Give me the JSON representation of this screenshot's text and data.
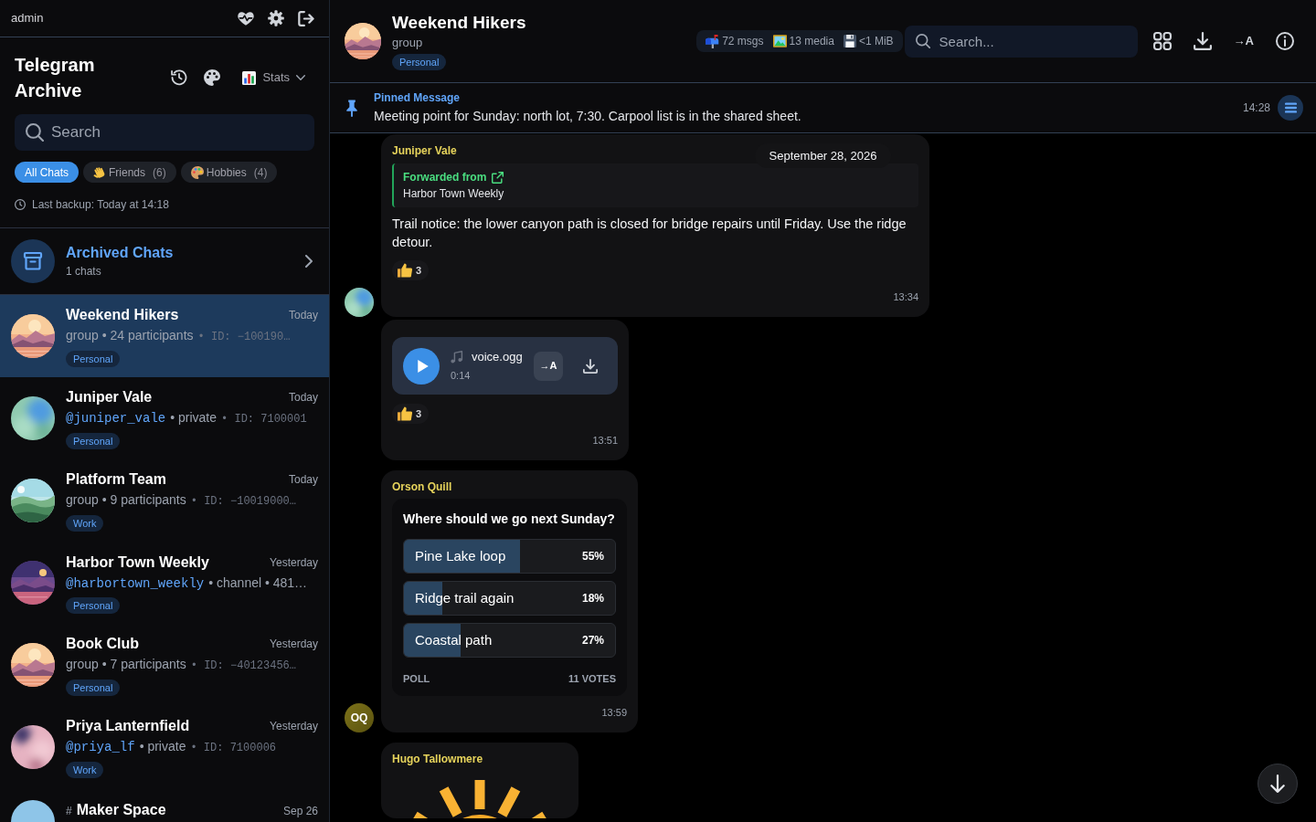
{
  "sidebar": {
    "user": "admin",
    "title": "Telegram Archive",
    "stats_menu": {
      "label": "Stats"
    },
    "search": {
      "placeholder": "Search"
    },
    "filters": [
      {
        "label": "All Chats",
        "selected": true
      },
      {
        "label": "Friends",
        "count": "(6)",
        "selected": false
      },
      {
        "label": "Hobbies",
        "count": "(4)",
        "selected": false
      }
    ],
    "last_backup": "Last backup: Today at 14:18",
    "archived": {
      "title": "Archived Chats",
      "subtitle": "1 chats"
    },
    "chats": [
      {
        "name": "Weekend Hikers",
        "date": "Today",
        "details": [
          {
            "kind": "plain",
            "text": "group • 24 participants"
          },
          {
            "kind": "id",
            "text": "• ID: −100190…"
          }
        ],
        "tag": "Personal",
        "selected": true
      },
      {
        "name": "Juniper Vale",
        "date": "Today",
        "details": [
          {
            "kind": "username",
            "text": "@juniper_vale"
          },
          {
            "kind": "plain",
            "text": "• private"
          },
          {
            "kind": "id",
            "text": "• ID: 7100001"
          }
        ],
        "tag": "Personal",
        "selected": false
      },
      {
        "name": "Platform Team",
        "date": "Today",
        "details": [
          {
            "kind": "plain",
            "text": "group • 9 participants"
          },
          {
            "kind": "id",
            "text": "• ID: −10019000…"
          }
        ],
        "tag": "Work",
        "selected": false
      },
      {
        "name": "Harbor Town Weekly",
        "date": "Yesterday",
        "details": [
          {
            "kind": "username",
            "text": "@harbortown_weekly"
          },
          {
            "kind": "plain",
            "text": "• channel • 481…"
          }
        ],
        "tag": "Personal",
        "selected": false
      },
      {
        "name": "Book Club",
        "date": "Yesterday",
        "details": [
          {
            "kind": "plain",
            "text": "group • 7 participants"
          },
          {
            "kind": "id",
            "text": "• ID: −40123456…"
          }
        ],
        "tag": "Personal",
        "selected": false
      },
      {
        "name": "Priya Lanternfield",
        "date": "Yesterday",
        "details": [
          {
            "kind": "username",
            "text": "@priya_lf"
          },
          {
            "kind": "plain",
            "text": "• private"
          },
          {
            "kind": "id",
            "text": "• ID: 7100006"
          }
        ],
        "tag": "Work",
        "selected": false
      },
      {
        "name": "Maker Space",
        "prefix": "#",
        "date": "Sep 26",
        "selected": false
      }
    ]
  },
  "chat_header": {
    "name": "Weekend Hikers",
    "type": "group",
    "tag": "Personal",
    "stats": [
      {
        "kind": "messages",
        "text": "72 msgs"
      },
      {
        "kind": "media",
        "text": "13 media"
      },
      {
        "kind": "size",
        "text": "<1 MiB"
      }
    ],
    "search": {
      "placeholder": "Search..."
    },
    "translate_label": "→A"
  },
  "pinned": {
    "label": "Pinned Message",
    "text": "Meeting point for Sunday: north lot, 7:30. Carpool list is in the shared sheet.",
    "time": "14:28"
  },
  "date_header": "September 28, 2026",
  "messages": [
    {
      "kind": "text",
      "sender": "Juniper Vale",
      "forwarded": {
        "label": "Forwarded from",
        "source": "Harbor Town Weekly"
      },
      "text": "Trail notice: the lower canyon path is closed for bridge repairs until Friday. Use the ridge detour.",
      "reactions": [
        {
          "count": "3"
        }
      ],
      "time": "13:34",
      "avatar": {
        "kind": "image"
      }
    },
    {
      "kind": "voice",
      "voice": {
        "file": "voice.ogg",
        "duration": "0:14",
        "translate_label": "→A"
      },
      "reactions": [
        {
          "count": "3"
        }
      ],
      "time": "13:51"
    },
    {
      "kind": "poll",
      "sender": "Orson Quill",
      "poll": {
        "question": "Where should we go next Sunday?",
        "options": [
          {
            "text": "Pine Lake loop",
            "percent": "55%",
            "level": 0.55
          },
          {
            "text": "Ridge trail again",
            "percent": "18%",
            "level": 0.18
          },
          {
            "text": "Coastal path",
            "percent": "27%",
            "level": 0.27
          }
        ],
        "type_label": "POLL",
        "votes": "11 VOTES"
      },
      "time": "13:59",
      "avatar": {
        "kind": "initials",
        "text": "OQ"
      }
    },
    {
      "kind": "sticker",
      "sender": "Hugo Tallowmere"
    }
  ]
}
